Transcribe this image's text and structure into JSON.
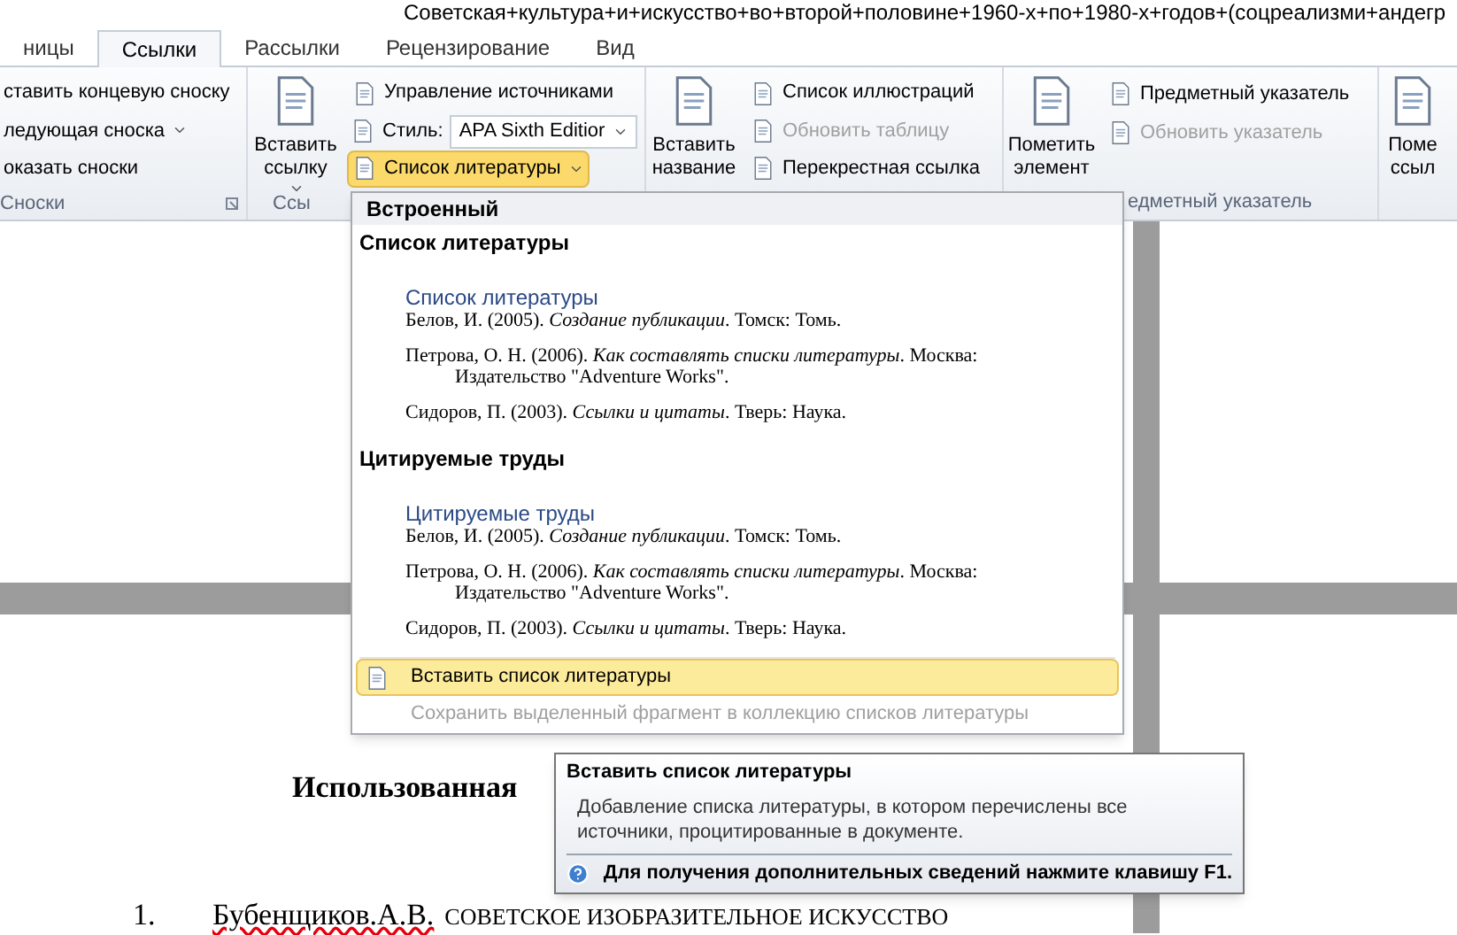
{
  "window": {
    "title": "Советская+культура+и+искусство+во+второй+половине+1960-х+по+1980-х+годов+(соцреализми+андегр"
  },
  "tabs": [
    {
      "label": "ницы",
      "selected": false
    },
    {
      "label": "Ссылки",
      "selected": true
    },
    {
      "label": "Рассылки",
      "selected": false
    },
    {
      "label": "Рецензирование",
      "selected": false
    },
    {
      "label": "Вид",
      "selected": false
    }
  ],
  "ribbon": {
    "groups": [
      {
        "label": "Сноски",
        "launcher": true,
        "items": [
          {
            "kind": "plain",
            "label": "ставить концевую сноску",
            "disabled": false
          },
          {
            "kind": "plain-menu",
            "label": "ледующая сноска",
            "disabled": false
          },
          {
            "kind": "plain",
            "label": "оказать сноски",
            "disabled": false
          }
        ]
      },
      {
        "label": "Ссы",
        "large": [
          {
            "kind": "large-menu",
            "label": "Вставить ссылку"
          }
        ],
        "items": [
          {
            "kind": "button",
            "label": "Управление источниками",
            "disabled": false,
            "open": false
          },
          {
            "kind": "combo",
            "label": "Стиль:",
            "value": "APA Sixth Editior",
            "disabled": false
          },
          {
            "kind": "menu-button",
            "label": "Список литературы",
            "disabled": false,
            "open": true
          }
        ]
      },
      {
        "large": [
          {
            "kind": "large",
            "label": "Вставить название"
          }
        ],
        "items": [
          {
            "kind": "button",
            "label": "Список иллюстраций",
            "disabled": false,
            "open": false
          },
          {
            "kind": "button",
            "label": "Обновить таблицу",
            "disabled": true,
            "open": false
          },
          {
            "kind": "button",
            "label": "Перекрестная ссылка",
            "disabled": false,
            "open": false
          }
        ]
      },
      {
        "label": "едметный указатель",
        "large": [
          {
            "kind": "large",
            "label": "Пометить элемент"
          }
        ],
        "items": [
          {
            "kind": "button",
            "label": "Предметный указатель",
            "disabled": false,
            "open": false
          },
          {
            "kind": "button",
            "label": "Обновить указатель",
            "disabled": true,
            "open": false
          }
        ]
      },
      {
        "large": [
          {
            "kind": "large",
            "label": "Поме ссыл"
          }
        ]
      }
    ]
  },
  "menu": {
    "header": "Встроенный",
    "sections": [
      {
        "label": "Список литературы",
        "preview_title": "Список литературы",
        "references": [
          "Белов, И. (2005). *Создание публикации*. Томск: Томь.",
          "Петрова, О. Н. (2006). *Как составлять списки литературы*. Москва: Издательство \"Adventure Works\".",
          "Сидоров, П. (2003). *Ссылки и цитаты*. Тверь: Наука."
        ]
      },
      {
        "label": "Цитируемые труды",
        "preview_title": "Цитируемые труды",
        "references": [
          "Белов, И. (2005). *Создание публикации*. Томск: Томь.",
          "Петрова, О. Н. (2006). *Как составлять списки литературы*. Москва: Издательство \"Adventure Works\".",
          "Сидоров, П. (2003). *Ссылки и цитаты*. Тверь: Наука."
        ]
      }
    ],
    "commands": [
      {
        "label": "Вставить список литературы",
        "selected": true,
        "disabled": false
      },
      {
        "label": "Сохранить выделенный фрагмент в коллекцию списков литературы",
        "selected": false,
        "disabled": true
      }
    ]
  },
  "tooltip": {
    "title": "Вставить список литературы",
    "description": "Добавление списка литературы, в котором перечислены все источники, процитированные в документе.",
    "help": "Для получения дополнительных сведений нажмите клавишу F1."
  },
  "document": {
    "heading": "Использованная",
    "list": [
      {
        "number": "1.",
        "author": "Бубенщиков.А.В.",
        "spelling_error": true,
        "title": "СОВЕТСКОЕ ИЗОБРАЗИТЕЛЬНОЕ ИСКУССТВО"
      }
    ]
  }
}
